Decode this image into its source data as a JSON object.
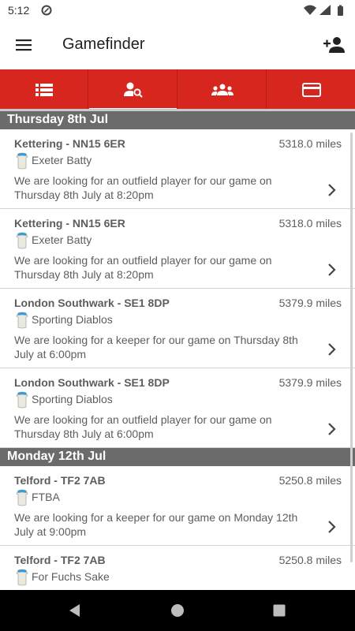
{
  "status": {
    "time": "5:12"
  },
  "app": {
    "title": "Gamefinder"
  },
  "tabs": [
    {
      "icon": "list-icon",
      "selected": false
    },
    {
      "icon": "person-search-icon",
      "selected": true
    },
    {
      "icon": "group-icon",
      "selected": false
    },
    {
      "icon": "card-icon",
      "selected": false
    }
  ],
  "colors": {
    "accent": "#d7261e",
    "header": "#6b6b6b"
  },
  "sections": [
    {
      "date": "Thursday 8th Jul",
      "items": [
        {
          "location": "Kettering - NN15 6ER",
          "distance": "5318.0 miles",
          "team": "Exeter Batty",
          "description": "We are looking for an outfield player for our game on Thursday 8th July at 8:20pm"
        },
        {
          "location": "Kettering - NN15 6ER",
          "distance": "5318.0 miles",
          "team": "Exeter Batty",
          "description": "We are looking for an outfield player for our game on Thursday 8th July at 8:20pm"
        },
        {
          "location": "London Southwark - SE1 8DP",
          "distance": "5379.9 miles",
          "team": "Sporting Diablos",
          "description": "We are looking for a keeper for our game on Thursday 8th July at 6:00pm"
        },
        {
          "location": "London Southwark - SE1 8DP",
          "distance": "5379.9 miles",
          "team": "Sporting Diablos",
          "description": "We are looking for an outfield player for our game on Thursday 8th July at 6:00pm"
        }
      ]
    },
    {
      "date": "Monday 12th Jul",
      "items": [
        {
          "location": "Telford - TF2 7AB",
          "distance": "5250.8 miles",
          "team": "FTBA",
          "description": "We are looking for a keeper for our game on Monday 12th July at 9:00pm"
        },
        {
          "location": "Telford - TF2 7AB",
          "distance": "5250.8 miles",
          "team": "For Fuchs Sake",
          "description": ""
        }
      ]
    }
  ]
}
